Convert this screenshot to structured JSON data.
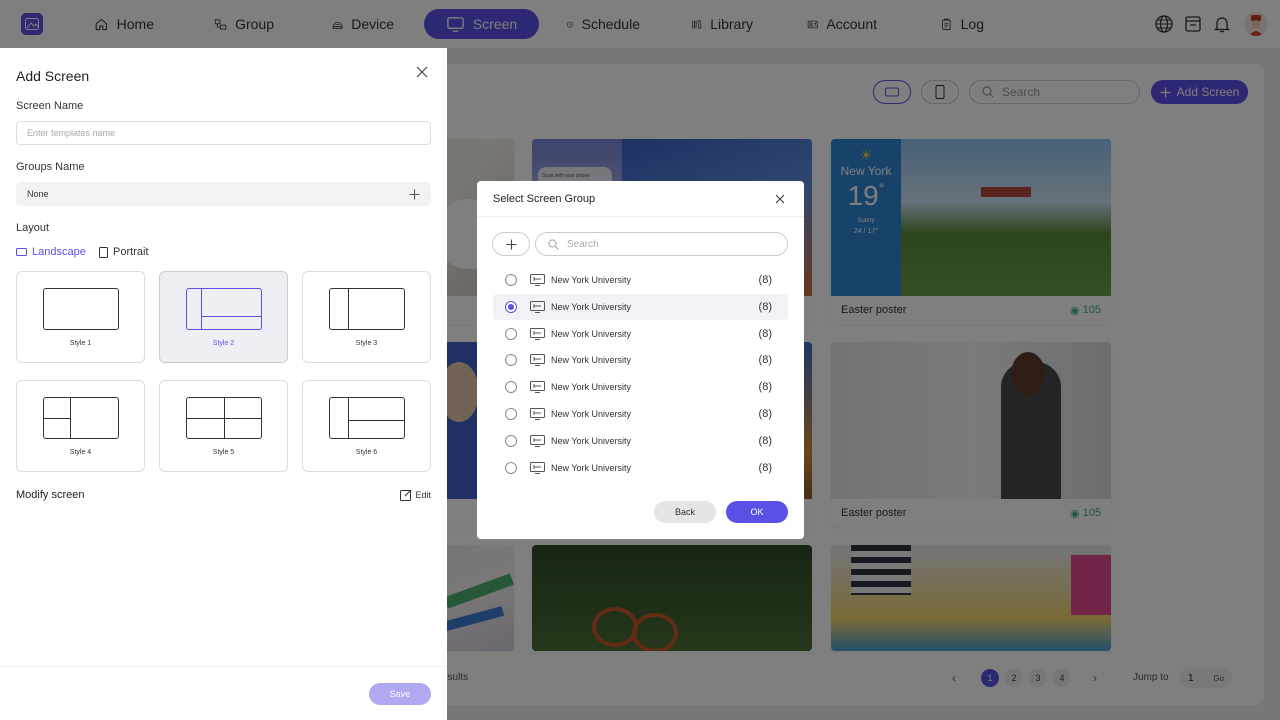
{
  "nav": {
    "items": [
      {
        "label": "Home",
        "icon": "home-icon"
      },
      {
        "label": "Group",
        "icon": "group-icon"
      },
      {
        "label": "Device",
        "icon": "device-icon"
      },
      {
        "label": "Screen",
        "icon": "screen-icon",
        "active": true
      },
      {
        "label": "Schedule",
        "icon": "clock-icon"
      },
      {
        "label": "Library",
        "icon": "library-icon"
      },
      {
        "label": "Account",
        "icon": "account-icon"
      },
      {
        "label": "Log",
        "icon": "log-icon"
      }
    ],
    "right_icons": [
      "globe-icon",
      "archive-icon",
      "bell-icon",
      "avatar"
    ]
  },
  "colors": {
    "accent": "#5b50e6",
    "views": "#3fb27f"
  },
  "background": {
    "search_placeholder": "Search",
    "add_screen_label": "Add Screen",
    "weather": {
      "city": "New York",
      "temp": "19",
      "degree": "°",
      "condition": "Sunny",
      "range": "24 / 17°"
    },
    "promo_text": "Scan with your phone",
    "cards": [
      {
        "title": "Easter poster",
        "views": "105"
      },
      {
        "title": "Easter poster",
        "views": "105"
      }
    ],
    "results_text": "esults",
    "pages": [
      "1",
      "2",
      "3",
      "4"
    ],
    "current_page": "1",
    "jump_label": "Jump to",
    "jump_value": "1",
    "go_label": "Go"
  },
  "drawer": {
    "title": "Add Screen",
    "screen_name_label": "Screen Name",
    "screen_name_placeholder": "Enter templates name",
    "groups_name_label": "Groups Name",
    "groups_name_value": "None",
    "layout_label": "Layout",
    "orientation": {
      "landscape": "Landscape",
      "portrait": "Portrait",
      "selected": "Landscape"
    },
    "styles": [
      "Style 1",
      "Style 2",
      "Style 3",
      "Style 4",
      "Style 5",
      "Style 6"
    ],
    "selected_style": "Style 2",
    "modify_label": "Modify screen",
    "edit_label": "Edit",
    "save_label": "Save"
  },
  "modal": {
    "title": "Select Screen Group",
    "search_placeholder": "Search",
    "groups": [
      {
        "name": "New York University",
        "count": "(8)"
      },
      {
        "name": "New York University",
        "count": "(8)"
      },
      {
        "name": "New York University",
        "count": "(8)"
      },
      {
        "name": "New York University",
        "count": "(8)"
      },
      {
        "name": "New York University",
        "count": "(8)"
      },
      {
        "name": "New York University",
        "count": "(8)"
      },
      {
        "name": "New York University",
        "count": "(8)"
      },
      {
        "name": "New York University",
        "count": "(8)"
      }
    ],
    "selected_index": 1,
    "back_label": "Back",
    "ok_label": "OK"
  }
}
